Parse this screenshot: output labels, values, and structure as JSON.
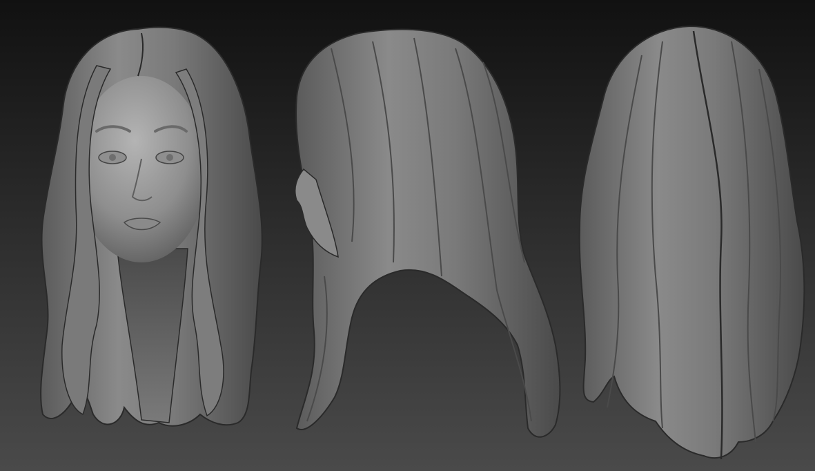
{
  "viewport": {
    "background_top": "#111111",
    "background_bottom": "#4a4a4a",
    "material_light": "#a9a9a9",
    "material_mid": "#7c7c7c",
    "material_dark": "#3a3a3a"
  },
  "views": [
    {
      "id": "front",
      "icon": "sculpt-head-front-view"
    },
    {
      "id": "side",
      "icon": "sculpt-head-side-view"
    },
    {
      "id": "back",
      "icon": "sculpt-head-back-view"
    }
  ]
}
